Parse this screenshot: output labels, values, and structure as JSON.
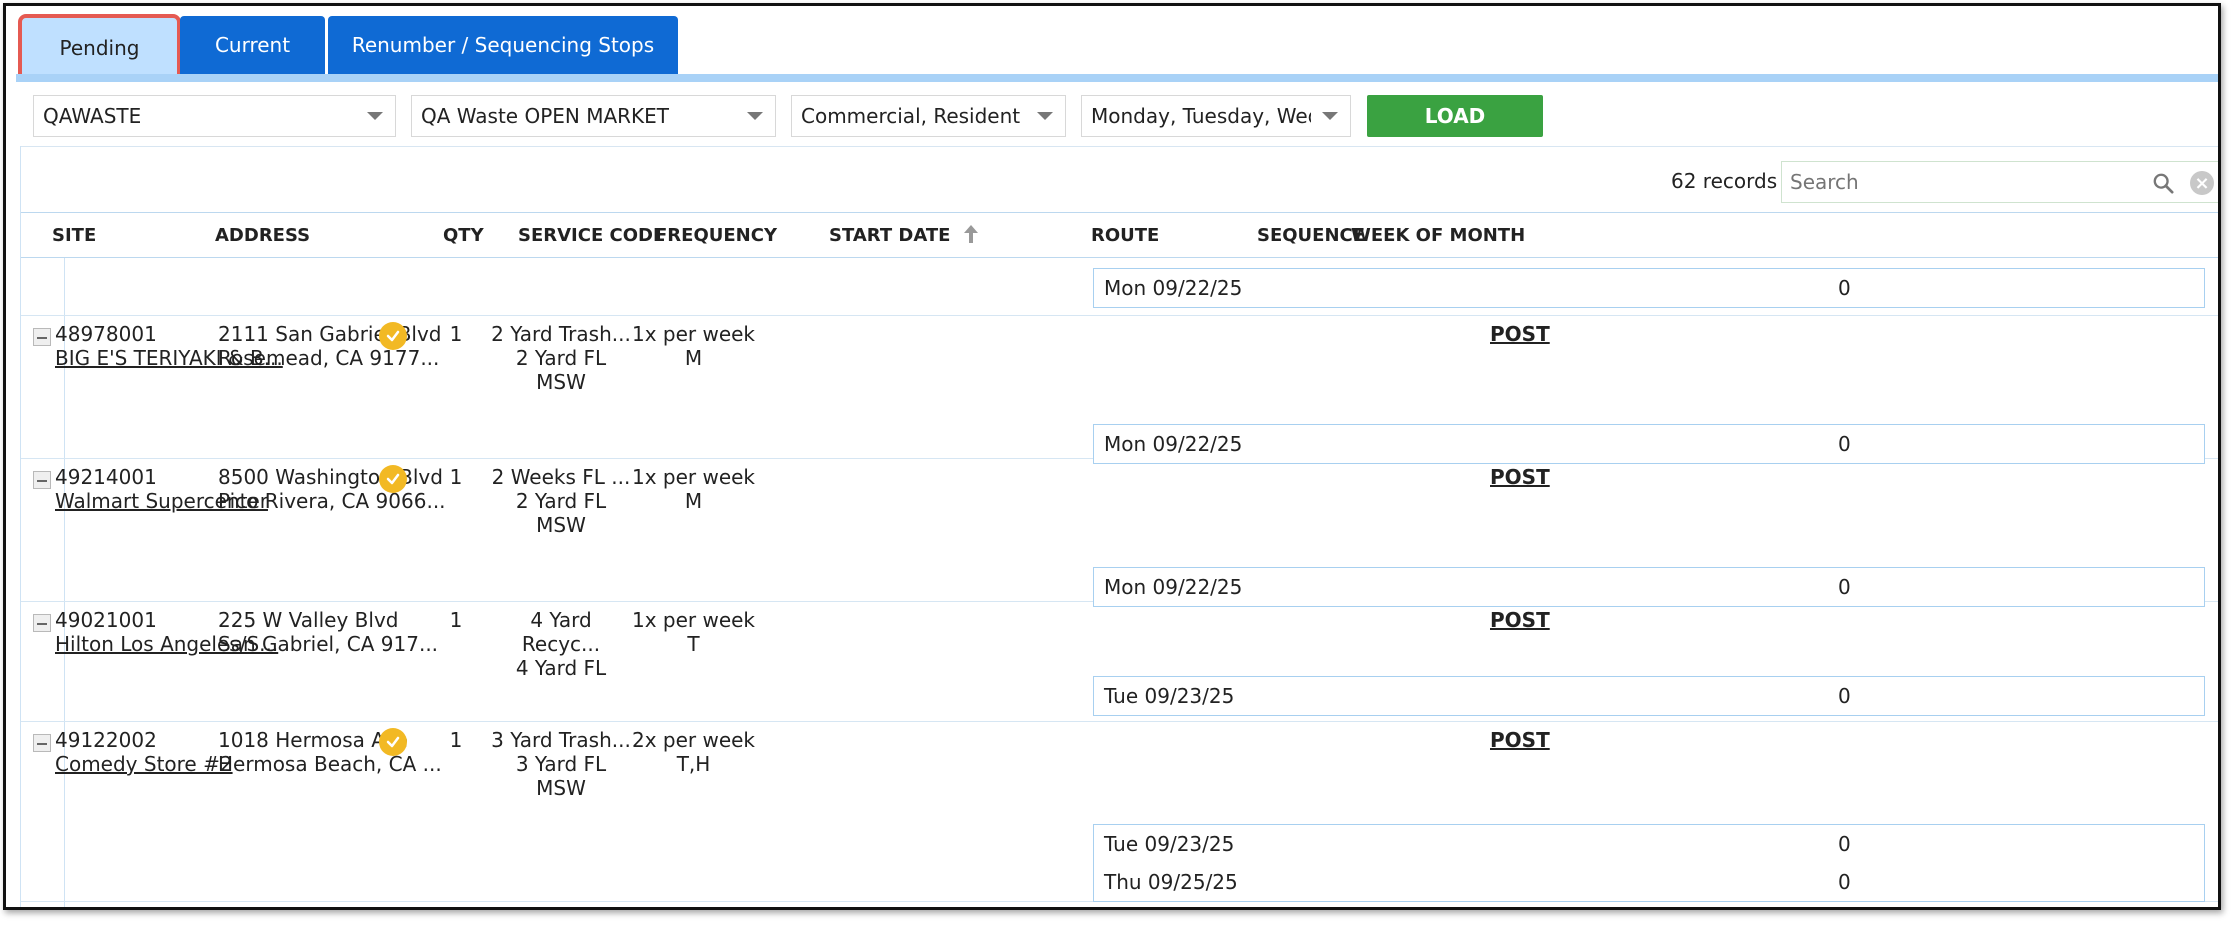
{
  "tabs": [
    {
      "label": "Pending",
      "active": true
    },
    {
      "label": "Current",
      "active": false
    },
    {
      "label": "Renumber / Sequencing Stops",
      "active": false
    }
  ],
  "filters": {
    "company": "QAWASTE",
    "market": "QA Waste OPEN MARKET",
    "service_type": "Commercial, Residential",
    "days": "Monday, Tuesday, Wednesday",
    "load_label": "LOAD"
  },
  "toolbar": {
    "records": "62 records",
    "search_placeholder": "Search"
  },
  "columns": {
    "site": "SITE",
    "address": "ADDRESS",
    "qty": "QTY",
    "service_code": "SERVICE CODE",
    "frequency": "FREQUENCY",
    "start_date": "START DATE",
    "route": "ROUTE",
    "sequence": "SEQUENCE",
    "week_of_month": "WEEK OF MONTH"
  },
  "top_schedule": {
    "date": "Mon 09/22/25",
    "sequence": "0"
  },
  "rows": [
    {
      "site_id": "48978001",
      "site_name": "BIG E'S TERIYAKI & B...",
      "addr1": "2111 San Gabriel Blvd",
      "addr2": "Rosemead, CA 9177...",
      "verified": true,
      "qty": "1",
      "service": [
        "2 Yard Trash...",
        "2 Yard FL",
        "MSW"
      ],
      "frequency": [
        "1x per week",
        "M"
      ],
      "post": "POST",
      "schedules": [
        {
          "date": "Mon 09/22/25",
          "sequence": "0"
        }
      ]
    },
    {
      "site_id": "49214001",
      "site_name": "Walmart Supercenter",
      "addr1": "8500 Washington Blvd",
      "addr2": "Pico Rivera, CA 9066...",
      "verified": true,
      "qty": "1",
      "service": [
        "2 Weeks FL ...",
        "2 Yard FL",
        "MSW"
      ],
      "frequency": [
        "1x per week",
        "M"
      ],
      "post": "POST",
      "schedules": [
        {
          "date": "Mon 09/22/25",
          "sequence": "0"
        }
      ]
    },
    {
      "site_id": "49021001",
      "site_name": "Hilton Los Angeles/S...",
      "addr1": "225 W Valley Blvd",
      "addr2": "San Gabriel, CA 917...",
      "verified": false,
      "qty": "1",
      "service": [
        "4 Yard Recyc...",
        "4 Yard FL"
      ],
      "frequency": [
        "1x per week",
        "T"
      ],
      "post": "POST",
      "schedules": [
        {
          "date": "Tue 09/23/25",
          "sequence": "0"
        }
      ]
    },
    {
      "site_id": "49122002",
      "site_name": "Comedy Store #2",
      "addr1": "1018 Hermosa Ave",
      "addr2": "Hermosa Beach, CA ...",
      "verified": true,
      "qty": "1",
      "service": [
        "3 Yard Trash...",
        "3 Yard FL",
        "MSW"
      ],
      "frequency": [
        "2x per week",
        "T,H"
      ],
      "post": "POST",
      "schedules": [
        {
          "date": "Tue 09/23/25",
          "sequence": "0"
        },
        {
          "date": "Thu 09/25/25",
          "sequence": "0"
        }
      ]
    }
  ],
  "colors": {
    "tab_blue": "#0f6ad4",
    "tab_active": "#bfe0ff",
    "highlight_red": "#e55a52",
    "load_green": "#3aa241",
    "check_yellow": "#f2b924"
  }
}
